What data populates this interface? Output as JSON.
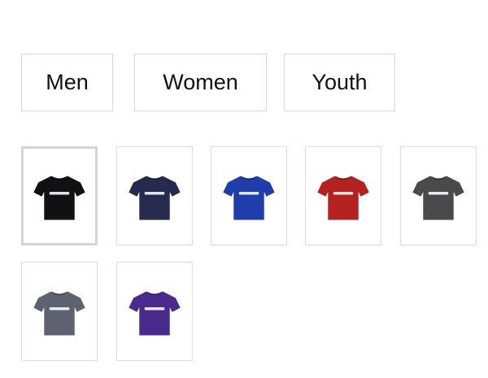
{
  "fit_options": [
    {
      "label": "Men"
    },
    {
      "label": "Women"
    },
    {
      "label": "Youth"
    }
  ],
  "color_swatches": [
    {
      "color": "#111114",
      "selected": true
    },
    {
      "color": "#262a4e",
      "selected": false
    },
    {
      "color": "#1f3dab",
      "selected": false
    },
    {
      "color": "#b5211f",
      "selected": false
    },
    {
      "color": "#4a4a4c",
      "selected": false
    },
    {
      "color": "#5d6170",
      "selected": false
    },
    {
      "color": "#4b2a8e",
      "selected": false
    }
  ]
}
